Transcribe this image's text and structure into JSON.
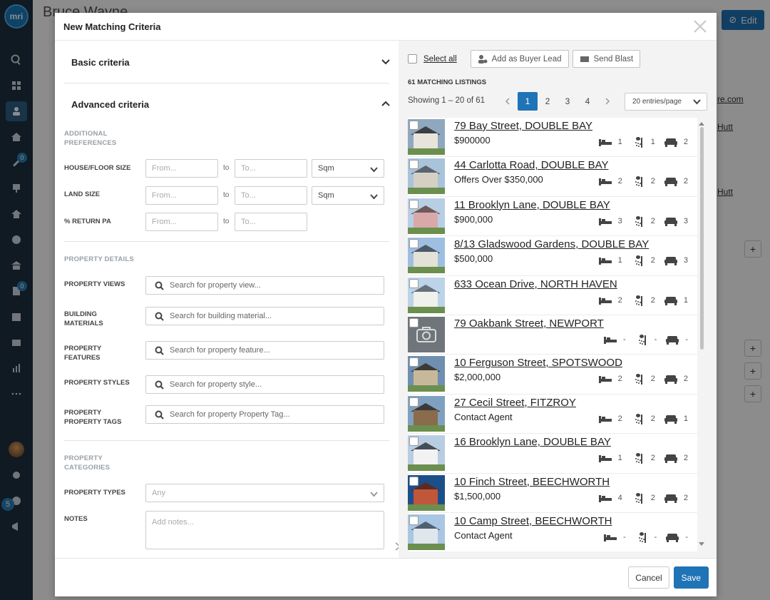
{
  "app": {
    "logo_text": "mri",
    "sidebar_badges": [
      "0",
      "0"
    ],
    "sidebar_count": "5"
  },
  "background": {
    "contact_name": "Bruce Wayne",
    "edit_label": "Edit",
    "link_1": "re.com",
    "link_2": "Hutt",
    "link_3": "Hutt"
  },
  "modal": {
    "title": "New Matching Criteria",
    "basic_criteria": "Basic criteria",
    "advanced_criteria": "Advanced criteria",
    "additional_preferences": "ADDITIONAL PREFERENCES",
    "house_floor_size": {
      "label": "HOUSE/FLOOR SIZE",
      "from_placeholder": "From...",
      "to_label": "to",
      "to_placeholder": "To...",
      "unit": "Sqm"
    },
    "land_size": {
      "label": "LAND SIZE",
      "from_placeholder": "From...",
      "to_label": "to",
      "to_placeholder": "To...",
      "unit": "Sqm"
    },
    "return_pa": {
      "label": "% RETURN PA",
      "from_placeholder": "From...",
      "to_label": "to",
      "to_placeholder": "To..."
    },
    "property_details": "PROPERTY DETAILS",
    "property_views": {
      "label": "PROPERTY VIEWS",
      "placeholder": "Search for property view..."
    },
    "building_materials": {
      "label": "BUILDING MATERIALS",
      "placeholder": "Search for building material..."
    },
    "property_features": {
      "label": "PROPERTY FEATURES",
      "placeholder": "Search for property feature..."
    },
    "property_styles": {
      "label": "PROPERTY STYLES",
      "placeholder": "Search for property style..."
    },
    "property_tags": {
      "label": "PROPERTY PROPERTY TAGS",
      "placeholder": "Search for property Property Tag..."
    },
    "property_categories": "PROPERTY CATEGORIES",
    "property_types": {
      "label": "PROPERTY TYPES",
      "value": "Any"
    },
    "notes": {
      "label": "NOTES",
      "placeholder": "Add notes..."
    },
    "cancel_label": "Cancel",
    "save_label": "Save"
  },
  "results": {
    "select_all": "Select all",
    "add_buyer_lead": "Add as Buyer Lead",
    "send_blast": "Send Blast",
    "count_label": "61 MATCHING LISTINGS",
    "showing": "Showing 1 – 20 of 61",
    "pages": [
      "1",
      "2",
      "3",
      "4"
    ],
    "current_page": "1",
    "per_page": "20 entries/page",
    "listings": [
      {
        "address": "79 Bay Street, DOUBLE BAY",
        "price": "$900000",
        "beds": "1",
        "baths": "1",
        "cars": "2",
        "image": "house-modern"
      },
      {
        "address": "44 Carlotta Road, DOUBLE BAY",
        "price": "Offers Over $350,000",
        "beds": "2",
        "baths": "2",
        "cars": "2",
        "image": "house-colonial"
      },
      {
        "address": "11 Brooklyn Lane, DOUBLE BAY",
        "price": "$900,000",
        "beds": "3",
        "baths": "2",
        "cars": "3",
        "image": "house-pink"
      },
      {
        "address": "8/13 Gladswood Gardens, DOUBLE BAY",
        "price": "$500,000",
        "beds": "1",
        "baths": "2",
        "cars": "3",
        "image": "house-craftsman"
      },
      {
        "address": "633 Ocean Drive, NORTH HAVEN",
        "price": "",
        "beds": "2",
        "baths": "2",
        "cars": "1",
        "image": "house-cottage"
      },
      {
        "address": "79 Oakbank Street, NEWPORT",
        "price": "",
        "beds": "-",
        "baths": "-",
        "cars": "-",
        "image": "placeholder-camera"
      },
      {
        "address": "10 Ferguson Street, SPOTSWOOD",
        "price": "$2,000,000",
        "beds": "2",
        "baths": "2",
        "cars": "2",
        "image": "house-farm"
      },
      {
        "address": "27 Cecil Street, FITZROY",
        "price": "Contact Agent",
        "beds": "2",
        "baths": "2",
        "cars": "1",
        "image": "house-river"
      },
      {
        "address": "16 Brooklyn Lane, DOUBLE BAY",
        "price": "",
        "beds": "1",
        "baths": "2",
        "cars": "2",
        "image": "house-white"
      },
      {
        "address": "10 Finch Street, BEECHWORTH",
        "price": "$1,500,000",
        "beds": "4",
        "baths": "2",
        "cars": "2",
        "image": "house-victorian"
      },
      {
        "address": "10 Camp Street, BEECHWORTH",
        "price": "Contact Agent",
        "beds": "-",
        "baths": "-",
        "cars": "-",
        "image": "house-blue"
      }
    ]
  },
  "colors": {
    "primary": "#1f73b7",
    "sidebar": "#1c3140",
    "overlay": "rgba(0,0,0,0.45)"
  }
}
